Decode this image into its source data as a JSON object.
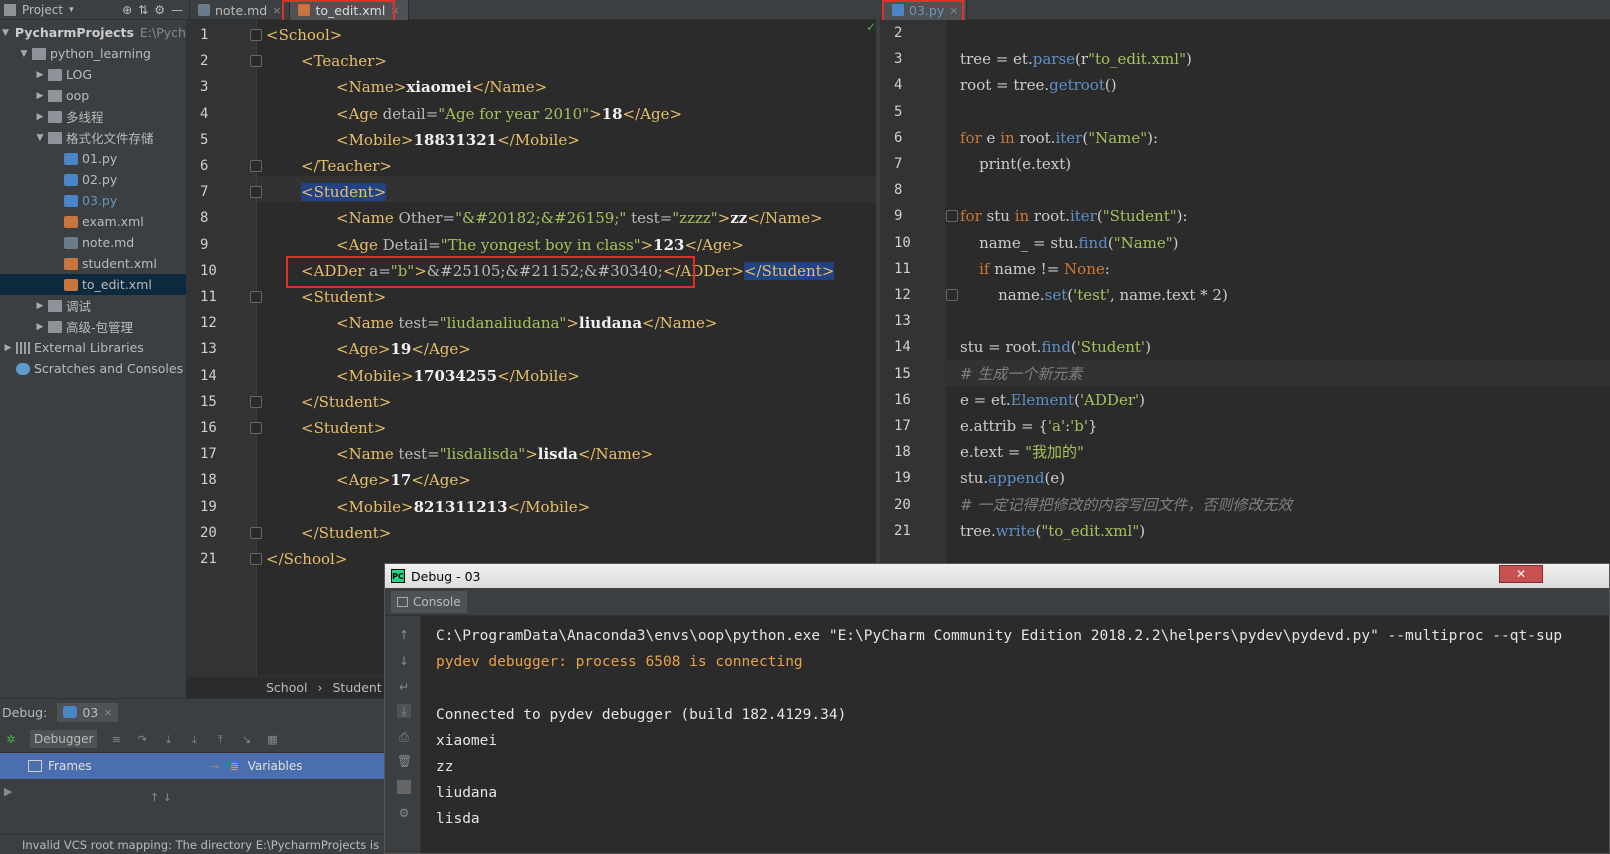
{
  "project": {
    "title": "Project",
    "root_name": "PycharmProjects",
    "root_path": "E:\\Pycha",
    "items": [
      {
        "label": "python_learning",
        "type": "folder",
        "level": 1,
        "arrow": "▼"
      },
      {
        "label": "LOG",
        "type": "folder",
        "level": 2,
        "arrow": "▶"
      },
      {
        "label": "oop",
        "type": "folder",
        "level": 2,
        "arrow": "▶"
      },
      {
        "label": "多线程",
        "type": "folder",
        "level": 2,
        "arrow": "▶"
      },
      {
        "label": "格式化文件存储",
        "type": "folder",
        "level": 2,
        "arrow": "▼"
      },
      {
        "label": "01.py",
        "type": "py",
        "level": 3
      },
      {
        "label": "02.py",
        "type": "py",
        "level": 3
      },
      {
        "label": "03.py",
        "type": "py",
        "level": 3
      },
      {
        "label": "exam.xml",
        "type": "xml",
        "level": 3
      },
      {
        "label": "note.md",
        "type": "md",
        "level": 3
      },
      {
        "label": "student.xml",
        "type": "xml",
        "level": 3
      },
      {
        "label": "to_edit.xml",
        "type": "xml",
        "level": 3
      },
      {
        "label": "调试",
        "type": "folder",
        "level": 2,
        "arrow": "▶"
      },
      {
        "label": "高级-包管理",
        "type": "folder",
        "level": 2,
        "arrow": "▶"
      },
      {
        "label": "External Libraries",
        "type": "lib",
        "level": 0,
        "arrow": "▶"
      },
      {
        "label": "Scratches and Consoles",
        "type": "scr",
        "level": 0
      }
    ]
  },
  "tabs_left": [
    {
      "label": "note.md"
    },
    {
      "label": "to_edit.xml"
    }
  ],
  "tabs_right": [
    {
      "label": "03.py"
    }
  ],
  "xml_lines": [
    [
      [
        "tg",
        "<School>"
      ]
    ],
    [
      [
        "tg",
        "<Teacher>"
      ]
    ],
    [
      [
        "tg",
        "<Name>"
      ],
      [
        "tx",
        "xiaomei"
      ],
      [
        "tg",
        "</Name>"
      ]
    ],
    [
      [
        "tg",
        "<Age "
      ],
      [
        "at",
        "detail="
      ],
      [
        "av",
        "\"Age for year 2010\""
      ],
      [
        "tg",
        ">"
      ],
      [
        "tx",
        "18"
      ],
      [
        "tg",
        "</Age>"
      ]
    ],
    [
      [
        "tg",
        "<Mobile>"
      ],
      [
        "tx",
        "18831321"
      ],
      [
        "tg",
        "</Mobile>"
      ]
    ],
    [
      [
        "tg",
        "</Teacher>"
      ]
    ],
    [
      [
        "tgsel",
        "<Student>"
      ]
    ],
    [
      [
        "tg",
        "<Name "
      ],
      [
        "at",
        "Other="
      ],
      [
        "av",
        "\"&#20182;&#26159;\""
      ],
      [
        "at",
        " test="
      ],
      [
        "av",
        "\"zzzz\""
      ],
      [
        "tg",
        ">"
      ],
      [
        "tx",
        "zz"
      ],
      [
        "tg",
        "</Name>"
      ]
    ],
    [
      [
        "tg",
        "<Age "
      ],
      [
        "at",
        "Detail="
      ],
      [
        "av",
        "\"The yongest boy in class\""
      ],
      [
        "tg",
        ">"
      ],
      [
        "tx",
        "123"
      ],
      [
        "tg",
        "</Age>"
      ]
    ],
    [
      [
        "tg",
        "<ADDer "
      ],
      [
        "at",
        "a="
      ],
      [
        "av",
        "\"b\""
      ],
      [
        "tg",
        ">"
      ],
      [
        "at",
        "&#25105;&#21152;&#30340;"
      ],
      [
        "tg",
        "</ADDer>"
      ],
      [
        "tgsel",
        "</Student>"
      ]
    ],
    [
      [
        "tg",
        "<Student>"
      ]
    ],
    [
      [
        "tg",
        "<Name "
      ],
      [
        "at",
        "test="
      ],
      [
        "av",
        "\"liudanaliudana\""
      ],
      [
        "tg",
        ">"
      ],
      [
        "tx",
        "liudana"
      ],
      [
        "tg",
        "</Name>"
      ]
    ],
    [
      [
        "tg",
        "<Age>"
      ],
      [
        "tx",
        "19"
      ],
      [
        "tg",
        "</Age>"
      ]
    ],
    [
      [
        "tg",
        "<Mobile>"
      ],
      [
        "tx",
        "17034255"
      ],
      [
        "tg",
        "</Mobile>"
      ]
    ],
    [
      [
        "tg",
        "</Student>"
      ]
    ],
    [
      [
        "tg",
        "<Student>"
      ]
    ],
    [
      [
        "tg",
        "<Name "
      ],
      [
        "at",
        "test="
      ],
      [
        "av",
        "\"lisdalisda\""
      ],
      [
        "tg",
        ">"
      ],
      [
        "tx",
        "lisda"
      ],
      [
        "tg",
        "</Name>"
      ]
    ],
    [
      [
        "tg",
        "<Age>"
      ],
      [
        "tx",
        "17"
      ],
      [
        "tg",
        "</Age>"
      ]
    ],
    [
      [
        "tg",
        "<Mobile>"
      ],
      [
        "tx",
        "821311213"
      ],
      [
        "tg",
        "</Mobile>"
      ]
    ],
    [
      [
        "tg",
        "</Student>"
      ]
    ],
    [
      [
        "tg",
        "</School>"
      ]
    ]
  ],
  "xml_line_numbers": [
    "1",
    "2",
    "3",
    "4",
    "5",
    "6",
    "7",
    "8",
    "9",
    "10",
    "11",
    "12",
    "13",
    "14",
    "15",
    "16",
    "17",
    "18",
    "19",
    "20",
    "21"
  ],
  "py_line_numbers": [
    "2",
    "3",
    "4",
    "5",
    "6",
    "7",
    "8",
    "9",
    "10",
    "11",
    "12",
    "13",
    "14",
    "15",
    "16",
    "17",
    "18",
    "19",
    "20",
    "21"
  ],
  "py_lines": [
    [],
    [
      [
        "nm",
        "tree = et."
      ],
      [
        "meth",
        "parse"
      ],
      [
        "nm",
        "(r"
      ],
      [
        "str",
        "\"to_edit.xml\""
      ],
      [
        "nm",
        ")"
      ]
    ],
    [
      [
        "nm",
        "root = tree."
      ],
      [
        "meth",
        "getroot"
      ],
      [
        "nm",
        "()"
      ]
    ],
    [],
    [
      [
        "kw",
        "for "
      ],
      [
        "nm",
        "e "
      ],
      [
        "kw",
        "in "
      ],
      [
        "nm",
        "root."
      ],
      [
        "meth",
        "iter"
      ],
      [
        "nm",
        "("
      ],
      [
        "str",
        "\"Name\""
      ],
      [
        "nm",
        "):"
      ]
    ],
    [
      [
        "nm",
        "    print(e.text)"
      ]
    ],
    [],
    [
      [
        "kw",
        "for "
      ],
      [
        "nm",
        "stu "
      ],
      [
        "kw",
        "in "
      ],
      [
        "nm",
        "root."
      ],
      [
        "meth",
        "iter"
      ],
      [
        "nm",
        "("
      ],
      [
        "str",
        "\"Student\""
      ],
      [
        "nm",
        "):"
      ]
    ],
    [
      [
        "nm",
        "    name_ = stu."
      ],
      [
        "meth",
        "find"
      ],
      [
        "nm",
        "("
      ],
      [
        "str",
        "\"Name\""
      ],
      [
        "nm",
        ")"
      ]
    ],
    [
      [
        "nm",
        "    "
      ],
      [
        "kw",
        "if "
      ],
      [
        "nm",
        "name != "
      ],
      [
        "kw",
        "None"
      ],
      [
        "nm",
        ":"
      ]
    ],
    [
      [
        "nm",
        "        name."
      ],
      [
        "meth",
        "set"
      ],
      [
        "nm",
        "("
      ],
      [
        "str",
        "'test'"
      ],
      [
        "nm",
        ", name.text * 2)"
      ]
    ],
    [],
    [
      [
        "nm",
        "stu = root."
      ],
      [
        "meth",
        "find"
      ],
      [
        "nm",
        "("
      ],
      [
        "str",
        "'Student'"
      ],
      [
        "nm",
        ")"
      ]
    ],
    [
      [
        "cm",
        "# 生成一个新元素"
      ]
    ],
    [
      [
        "nm",
        "e = et."
      ],
      [
        "meth",
        "Element"
      ],
      [
        "nm",
        "("
      ],
      [
        "str",
        "'ADDer'"
      ],
      [
        "nm",
        ")"
      ]
    ],
    [
      [
        "nm",
        "e.attrib = {"
      ],
      [
        "str",
        "'a'"
      ],
      [
        "nm",
        ":"
      ],
      [
        "str",
        "'b'"
      ],
      [
        "nm",
        "}"
      ]
    ],
    [
      [
        "nm",
        "e.text = "
      ],
      [
        "str",
        "\"我加的\""
      ]
    ],
    [
      [
        "nm",
        "stu."
      ],
      [
        "meth",
        "append"
      ],
      [
        "nm",
        "(e)"
      ]
    ],
    [
      [
        "cm",
        "# 一定记得把修改的内容写回文件，否则修改无效"
      ]
    ],
    [
      [
        "nm",
        "tree."
      ],
      [
        "meth",
        "write"
      ],
      [
        "nm",
        "("
      ],
      [
        "str",
        "\"to_edit.xml\""
      ],
      [
        "nm",
        ")"
      ]
    ]
  ],
  "breadcrumb": {
    "a": "School",
    "sep": "›",
    "b": "Student"
  },
  "debug": {
    "label": "Debug:",
    "config": "03",
    "debugger_tab": "Debugger",
    "frames": "Frames",
    "variables": "Variables",
    "status": "Invalid VCS root mapping: The directory E:\\PycharmProjects is"
  },
  "debug_window": {
    "title": "Debug - 03",
    "close": "✕",
    "console_tab": "Console",
    "lines": [
      {
        "text": "C:\\ProgramData\\Anaconda3\\envs\\oop\\python.exe \"E:\\PyCharm Community Edition 2018.2.2\\helpers\\pydev\\pydevd.py\" --multiproc --qt-sup",
        "style": "normal"
      },
      {
        "text": "pydev debugger: process 6508 is connecting",
        "style": "orange"
      },
      {
        "text": "",
        "style": "normal"
      },
      {
        "text": "Connected to pydev debugger (build 182.4129.34)",
        "style": "normal"
      },
      {
        "text": "xiaomei",
        "style": "normal"
      },
      {
        "text": "zz",
        "style": "normal"
      },
      {
        "text": "liudana",
        "style": "normal"
      },
      {
        "text": "lisda",
        "style": "normal"
      }
    ]
  },
  "colors": {
    "accent": "#e0302a",
    "selection": "#214283"
  }
}
